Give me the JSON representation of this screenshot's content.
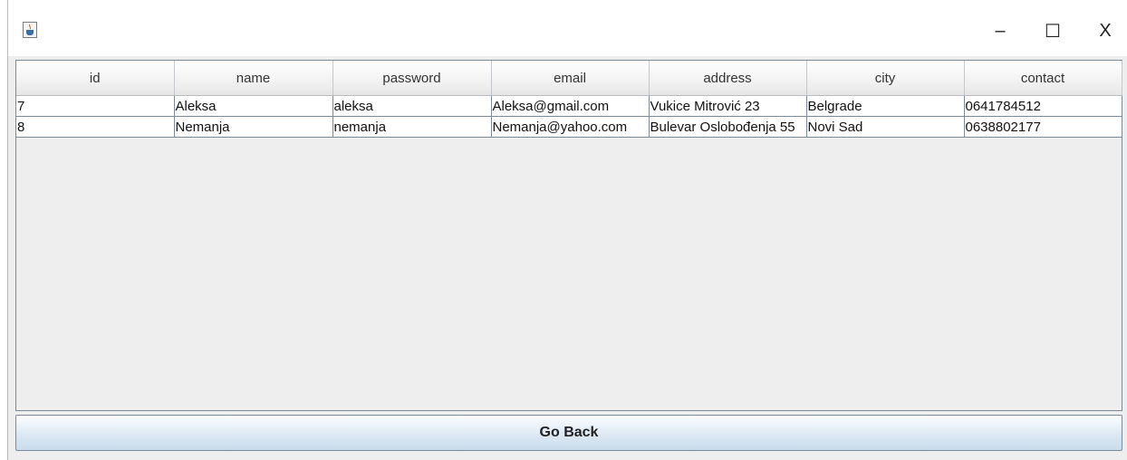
{
  "window": {
    "icon": "java-coffee-icon",
    "controls": {
      "minimize": "–",
      "maximize": "☐",
      "close": "X"
    }
  },
  "table": {
    "columns": [
      "id",
      "name",
      "password",
      "email",
      "address",
      "city",
      "contact"
    ],
    "rows": [
      [
        "7",
        "Aleksa",
        "aleksa",
        "Aleksa@gmail.com",
        "Vukice Mitrović 23",
        "Belgrade",
        "0641784512"
      ],
      [
        "8",
        "Nemanja",
        "nemanja",
        "Nemanja@yahoo.com",
        "Bulevar Oslobođenja 55",
        "Novi Sad",
        "0638802177"
      ]
    ]
  },
  "footer": {
    "go_back_label": "Go Back"
  }
}
